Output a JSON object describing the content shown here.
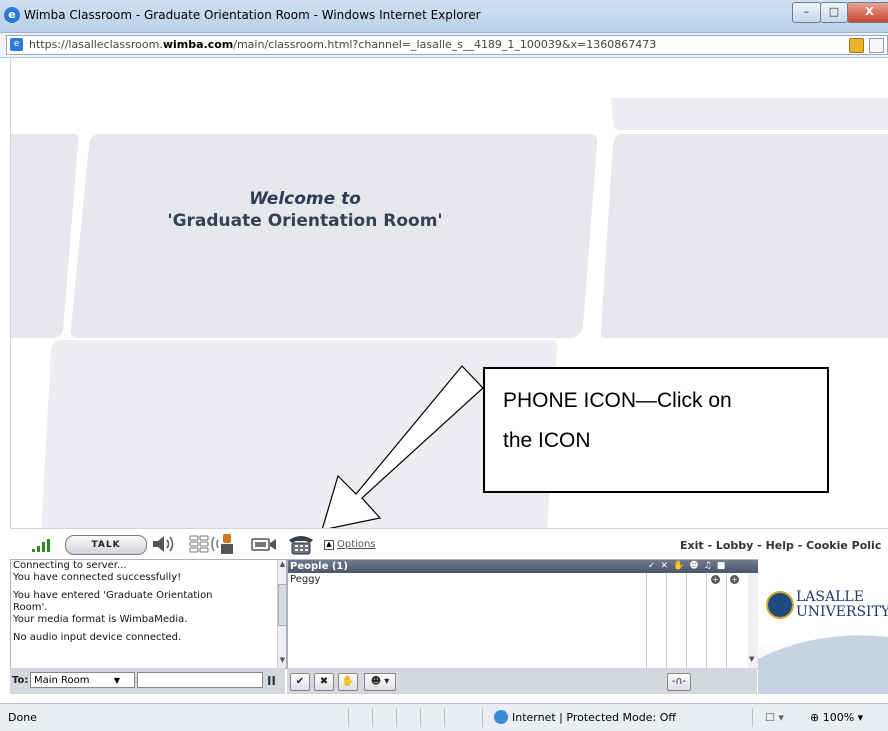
{
  "window": {
    "title": "Wimba Classroom - Graduate Orientation Room - Windows Internet Explorer",
    "minimize_label": "–",
    "maximize_label": "□",
    "close_label": "X"
  },
  "address_bar": {
    "url_prefix": "https://lasalleclassroom.",
    "url_domain": "wimba.com",
    "url_path": "/main/classroom.html?channel=_lasalle_s__4189_1_100039&x=1360867473"
  },
  "welcome": {
    "line1": "Welcome to",
    "line2": "'Graduate Orientation Room'"
  },
  "callout": {
    "line1": "PHONE ICON—Click on",
    "line2": "the ICON"
  },
  "toolbar": {
    "talk_label": "TALK",
    "options_label": "Options",
    "links": "Exit - Lobby - Help - Cookie Polic"
  },
  "chat": {
    "messages": [
      "Connecting to server...",
      "You have connected successfully!",
      "",
      "You have entered 'Graduate Orientation",
      "Room'.",
      "Your media format is WimbaMedia.",
      "",
      "No audio input device connected."
    ],
    "to_label": "To:",
    "room_selected": "Main Room",
    "pause_label": "II"
  },
  "people": {
    "header": "People (1)",
    "header_icons": "✓✕✋☻♫■",
    "participants": [
      "Peggy"
    ]
  },
  "people_tools": {
    "check": "✔",
    "cross": "✖",
    "hand": "✋",
    "emote": "☻ ▾",
    "meter": "-∩-"
  },
  "logo": {
    "line1": "LASALLE",
    "line2": "UNIVERSITY"
  },
  "status": {
    "left": "Done",
    "zone": "Internet | Protected Mode: Off",
    "security": "☐ ▾",
    "zoom": "⊕ 100%  ▾"
  }
}
